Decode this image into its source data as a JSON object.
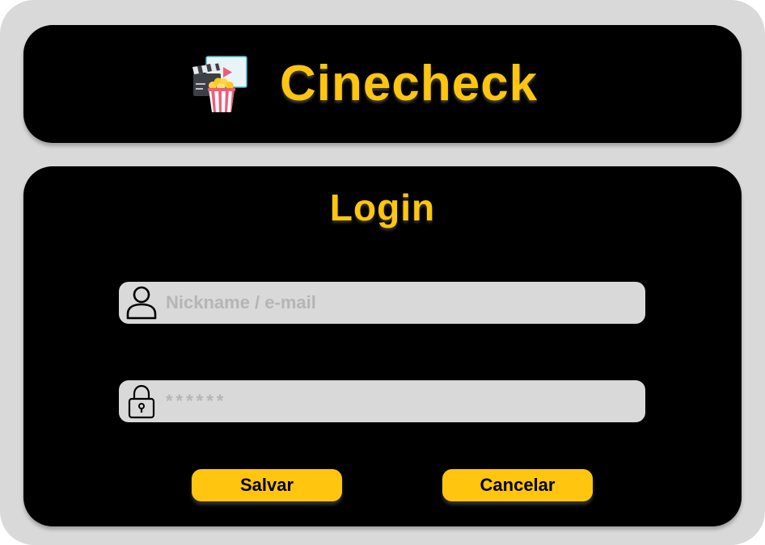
{
  "app": {
    "title": "Cinecheck",
    "logo_icon": "cinema-popcorn-icon"
  },
  "login": {
    "title": "Login",
    "username": {
      "icon": "user-icon",
      "placeholder": "Nickname / e-mail",
      "value": ""
    },
    "password": {
      "icon": "lock-icon",
      "placeholder": "******",
      "value": ""
    },
    "buttons": {
      "save_label": "Salvar",
      "cancel_label": "Cancelar"
    }
  },
  "colors": {
    "accent": "#ffc50f",
    "card_background": "#000000",
    "frame_background": "#d9d9d9",
    "field_background": "#d9d9d9"
  }
}
